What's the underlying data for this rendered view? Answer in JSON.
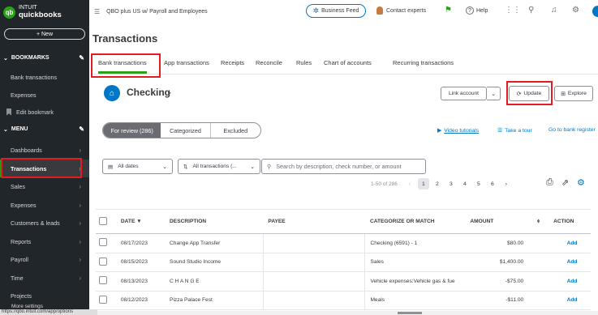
{
  "logo": {
    "line1": "INTUIT",
    "line2": "quickbooks"
  },
  "sidebar": {
    "new_label": "+ New",
    "bookmarks_label": "BOOKMARKS",
    "menu_label": "MENU",
    "bookmark_items": [
      {
        "label": "Bank transactions"
      },
      {
        "label": "Expenses"
      },
      {
        "label": "Edit bookmark"
      }
    ],
    "menu_items": [
      {
        "label": "Dashboards"
      },
      {
        "label": "Transactions"
      },
      {
        "label": "Sales"
      },
      {
        "label": "Expenses"
      },
      {
        "label": "Customers & leads"
      },
      {
        "label": "Reports"
      },
      {
        "label": "Payroll"
      },
      {
        "label": "Time"
      },
      {
        "label": "Projects"
      }
    ],
    "more_label": "More settings"
  },
  "status_url": "https://qbo.intuit.com/app/options",
  "topbar": {
    "company": "QBO plus US w/ Payroll and Employees",
    "business_feed": "Business Feed",
    "contact": "Contact experts",
    "help": "Help"
  },
  "page": {
    "title": "Transactions"
  },
  "tabs": [
    {
      "label": "Bank transactions"
    },
    {
      "label": "App transactions"
    },
    {
      "label": "Receipts"
    },
    {
      "label": "Reconcile"
    },
    {
      "label": "Rules"
    },
    {
      "label": "Chart of accounts"
    },
    {
      "label": "Recurring transactions"
    }
  ],
  "account": {
    "name": "Checking",
    "link_account": "Link account",
    "update": "Update",
    "explore": "Explore"
  },
  "filters": {
    "for_review": "For review (286)",
    "categorized": "Categorized",
    "excluded": "Excluded",
    "video_tutorials": "Video tutorials",
    "take_tour": "Take a tour",
    "go_to_register": "Go to bank register",
    "dates": "All dates",
    "transactions": "All transactions (...",
    "search_placeholder": "Search by description, check number, or amount"
  },
  "pager": {
    "range": "1-50 of 286",
    "prev": "‹",
    "next": "›",
    "pages": [
      "1",
      "2",
      "3",
      "4",
      "5",
      "6"
    ]
  },
  "table": {
    "headers": {
      "date": "DATE ▼",
      "description": "DESCRIPTION",
      "payee": "PAYEE",
      "category": "CATEGORIZE OR MATCH",
      "amount": "AMOUNT",
      "action": "ACTION"
    },
    "rows": [
      {
        "date": "08/17/2023",
        "description": "Change App Transfer",
        "payee": "",
        "category": "Checking (6591) - 1",
        "amount": "$80.00",
        "action": "Add"
      },
      {
        "date": "08/15/2023",
        "description": "Sound Studio Income",
        "payee": "",
        "category": "Sales",
        "amount": "$1,400.00",
        "action": "Add"
      },
      {
        "date": "08/13/2023",
        "description": "C H A N G E",
        "payee": "",
        "category": "Vehicle expenses:Vehicle gas & fue",
        "amount": "-$75.00",
        "action": "Add"
      },
      {
        "date": "08/12/2023",
        "description": "Pizza Palace Fest",
        "payee": "",
        "category": "Meals",
        "amount": "-$11.00",
        "action": "Add"
      }
    ]
  },
  "colors": {
    "accent": "#2ca01c",
    "link": "#0077c5",
    "highlight": "#e31c24",
    "sidebar": "#21262a"
  }
}
